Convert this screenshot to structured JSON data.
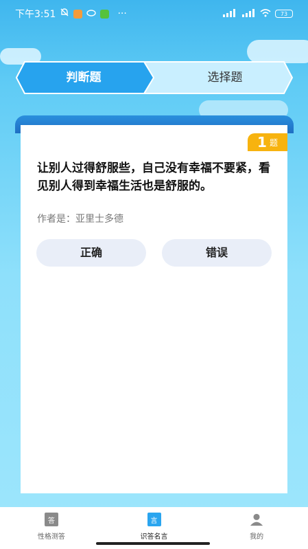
{
  "status_bar": {
    "time": "下午3:51",
    "battery": "73",
    "dots": "···"
  },
  "tabs": [
    {
      "label": "判断题",
      "active": true
    },
    {
      "label": "选择题",
      "active": false
    }
  ],
  "card": {
    "badge_number": "1",
    "badge_unit": "题",
    "question": "让别人过得舒服些，自己没有幸福不要紧，看见别人得到幸福生活也是舒服的。",
    "author": "作者是：亚里士多德",
    "answers": {
      "correct": "正确",
      "wrong": "错误"
    }
  },
  "bottom_nav": [
    {
      "label": "性格测答",
      "icon": "answer-book-icon",
      "glyph": "答"
    },
    {
      "label": "识答名言",
      "icon": "quote-book-icon",
      "glyph": "言",
      "active": true
    },
    {
      "label": "我的",
      "icon": "user-profile-icon"
    }
  ],
  "colors": {
    "primary": "#1f8fe3",
    "badge": "#f7b30f",
    "button_bg": "#e9eef8"
  }
}
